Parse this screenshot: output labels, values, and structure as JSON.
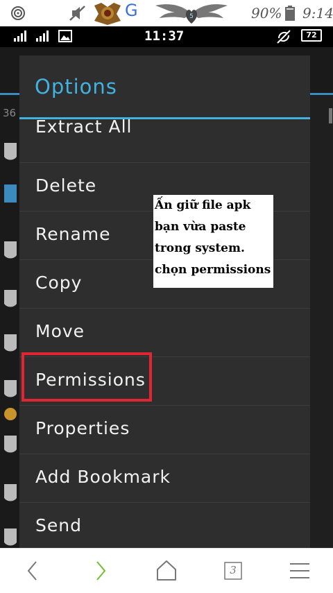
{
  "outer_status": {
    "g_label": "G",
    "badge_number": "5",
    "battery_percent": "90%",
    "time": "9:14",
    "icons": [
      "spiral-icon",
      "mute-icon",
      "badge-icon",
      "google-icon",
      "wings-icon",
      "battery-icon"
    ]
  },
  "inner_status": {
    "time": "11:37",
    "battery": "72",
    "icons": [
      "signal-icon",
      "signal-icon",
      "image-icon",
      "sync-off-icon",
      "battery-icon"
    ]
  },
  "background": {
    "count_text": "36"
  },
  "dialog": {
    "title": "Options",
    "items": [
      {
        "label": "Extract All"
      },
      {
        "label": "Delete"
      },
      {
        "label": "Rename"
      },
      {
        "label": "Copy"
      },
      {
        "label": "Move"
      },
      {
        "label": "Permissions",
        "highlighted": true
      },
      {
        "label": "Properties"
      },
      {
        "label": "Add Bookmark"
      },
      {
        "label": "Send"
      }
    ]
  },
  "annotation": {
    "lines": [
      "Ấn giữ file apk",
      "bạn vừa paste",
      "trong system.",
      "chọn permissions"
    ],
    "highlight_color": "#e02533"
  },
  "bottom_bar": {
    "tab_count": "3",
    "icons": [
      "back-icon",
      "forward-icon",
      "home-icon",
      "tabs-icon",
      "menu-icon"
    ],
    "forward_color": "#6fbf2f"
  },
  "colors": {
    "accent": "#41b3e0",
    "dialog_bg": "#2e2e2e"
  }
}
